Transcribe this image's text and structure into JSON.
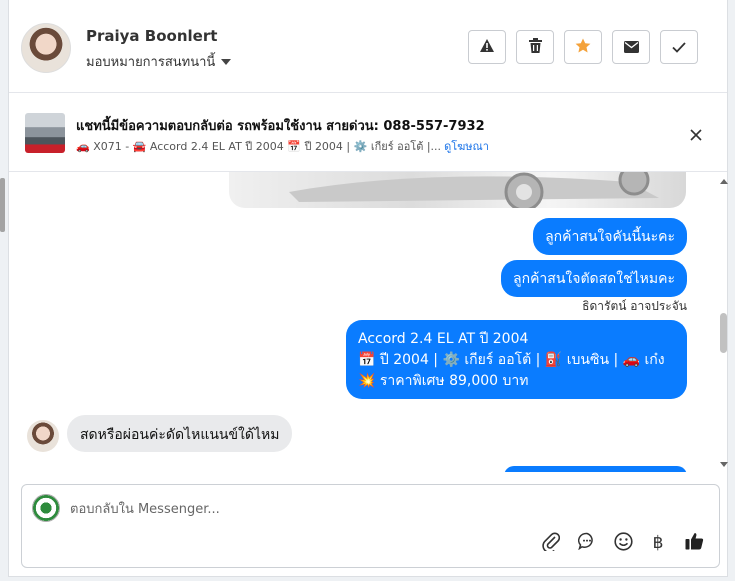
{
  "header": {
    "name": "Praiya Boonlert",
    "assign_label": "มอบหมายการสนทนานี้",
    "actions": [
      "report-icon",
      "trash-icon",
      "star-icon",
      "mail-icon",
      "check-icon"
    ],
    "star_color": "#f4a23b"
  },
  "ad": {
    "title": "แชทนี้มีข้อความตอบกลับต่อ รถพร้อมใช้งาน สายด่วน: 088-557-7932",
    "subtitle": "🚗 X071 - 🚘 Accord 2.4 EL AT ปี 2004 📅 ปี 2004 | ⚙️ เกียร์ ออโต้ |...",
    "link": "ดูโฆษณา"
  },
  "messages": {
    "out1": "ลูกค้าสนใจคันนี้นะคะ",
    "out2": "ลูกค้าสนใจตัดสดใช่ไหมคะ",
    "sender": "ธิดารัตน์ อาจประจัน",
    "out3_line1": "Accord 2.4 EL AT ปี 2004",
    "out3_line2": "📅 ปี 2004 | ⚙️ เกียร์ ออโต้ | ⛽ เบนซิน | 🚗 เก๋ง",
    "out3_line3": "💥 ราคาพิเศษ 89,000 บาท",
    "in1": "สดหรือผ่อนค่ะดัดไหแนนข์ใด้ไหม"
  },
  "composer": {
    "placeholder": "ตอบกลับใน Messenger...",
    "tools": [
      "attach-icon",
      "chat-icon",
      "emoji-icon",
      "baht-icon",
      "like-icon"
    ],
    "baht_symbol": "฿"
  },
  "colors": {
    "accent": "#0a7cff",
    "bubble_in": "#e9eaec"
  }
}
